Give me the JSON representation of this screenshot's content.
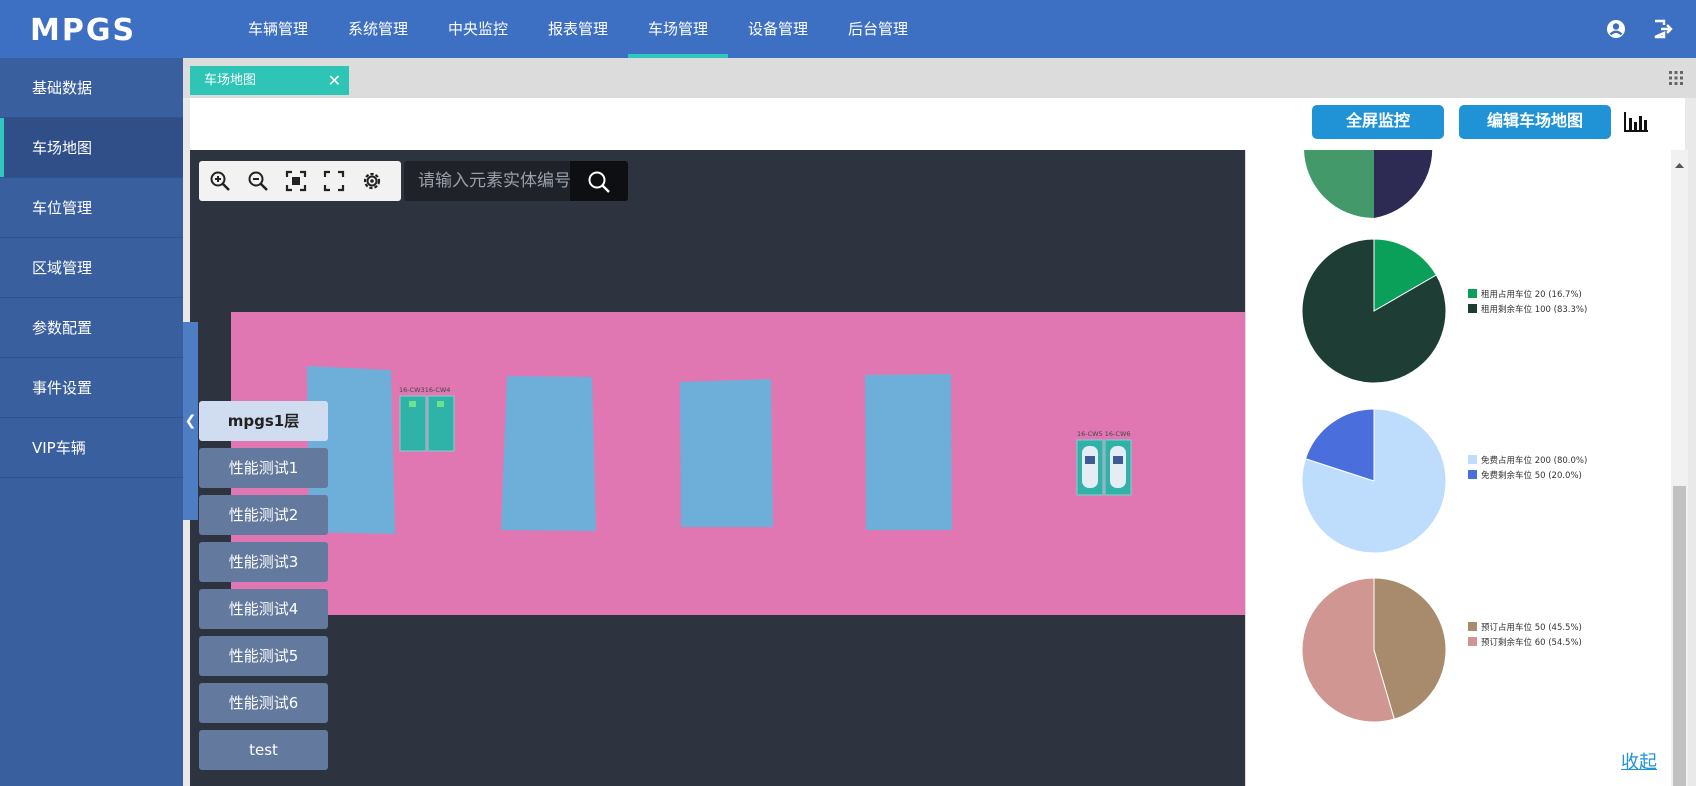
{
  "app": {
    "logo_text": "MPGS"
  },
  "topnav": {
    "items": [
      {
        "label": "车辆管理"
      },
      {
        "label": "系统管理"
      },
      {
        "label": "中央监控"
      },
      {
        "label": "报表管理"
      },
      {
        "label": "车场管理",
        "active": true
      },
      {
        "label": "设备管理"
      },
      {
        "label": "后台管理"
      }
    ],
    "icons": [
      "user-icon",
      "logout-icon"
    ]
  },
  "sidebar": {
    "items": [
      {
        "label": "基础数据"
      },
      {
        "label": "车场地图",
        "active": true
      },
      {
        "label": "车位管理"
      },
      {
        "label": "区域管理"
      },
      {
        "label": "参数配置"
      },
      {
        "label": "事件设置"
      },
      {
        "label": "VIP车辆"
      }
    ]
  },
  "tabs": [
    {
      "label": "车场地图",
      "close": "✕"
    }
  ],
  "toolbar": {
    "fullscreen_monitor": "全屏监控",
    "edit_map": "编辑车场地图"
  },
  "map": {
    "tools": [
      "zoom-in-icon",
      "zoom-out-icon",
      "fit-icon",
      "fullscreen-icon",
      "settings-icon"
    ],
    "search_placeholder": "请输入元素实体编号",
    "collapse_arrow": "❮",
    "spots": [
      {
        "label": "16-CW316-CW4"
      },
      {
        "label": "16-CW5 16-CW6"
      }
    ],
    "floors": [
      {
        "label": "mpgs1层",
        "active": true
      },
      {
        "label": "性能测试1"
      },
      {
        "label": "性能测试2"
      },
      {
        "label": "性能测试3"
      },
      {
        "label": "性能测试4"
      },
      {
        "label": "性能测试5"
      },
      {
        "label": "性能测试6"
      },
      {
        "label": "test"
      }
    ]
  },
  "stats": {
    "pies": [
      {
        "legend": [
          {
            "label": "租用占用车位 20 (16.7%)",
            "color": "#0aa05a",
            "value": 20
          },
          {
            "label": "租用剩余车位 100 (83.3%)",
            "color": "#1d3d35",
            "value": 100
          }
        ]
      },
      {
        "legend": [
          {
            "label": "免费占用车位 200 (80.0%)",
            "color": "#bedcfb",
            "value": 200
          },
          {
            "label": "免费剩余车位 50 (20.0%)",
            "color": "#4a6edb",
            "value": 50
          }
        ]
      },
      {
        "legend": [
          {
            "label": "预订占用车位 50 (45.5%)",
            "color": "#a88a6c",
            "value": 50
          },
          {
            "label": "预订剩余车位 60 (54.5%)",
            "color": "#cf9692",
            "value": 60
          }
        ]
      }
    ],
    "collapse_label": "收起"
  },
  "colors": {
    "nav_bg": "#3d6fc2",
    "sidebar_bg": "#3a5f9e",
    "accent": "#2ec8c0",
    "button_blue": "#1f93d6",
    "map_bg": "#2e3340",
    "zone_pink": "#e177b2",
    "block_blue": "#6dafd9"
  }
}
